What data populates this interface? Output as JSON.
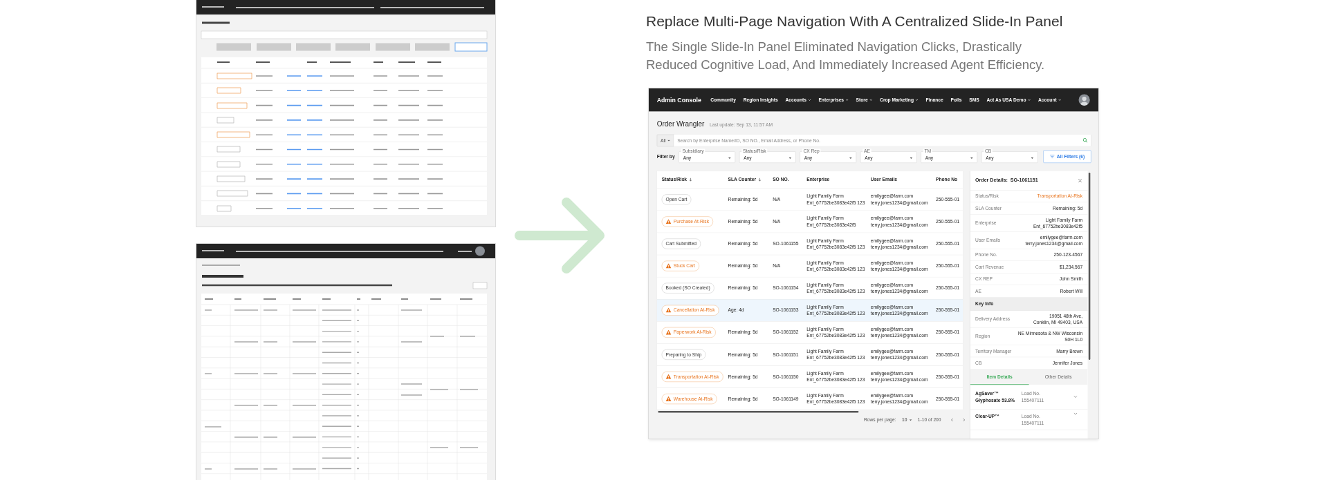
{
  "headline": "Replace Multi-Page Navigation With A Centralized Slide-In Panel",
  "description": [
    "The Single Slide-In Panel Eliminated Navigation Clicks, Drastically",
    "Reduced Cognitive Load, And Immediately Increased Agent Efficiency."
  ],
  "after_screen": {
    "nav": {
      "brand": "Admin Console",
      "avatar": true,
      "items": [
        {
          "label": "Community",
          "dropdown": false
        },
        {
          "label": "Region Insights",
          "dropdown": false
        },
        {
          "label": "Accounts",
          "dropdown": true
        },
        {
          "label": "Enterprises",
          "dropdown": true
        },
        {
          "label": "Store",
          "dropdown": true
        },
        {
          "label": "Crop Marketing",
          "dropdown": true
        },
        {
          "label": "Finance",
          "dropdown": false
        },
        {
          "label": "Polls",
          "dropdown": false
        },
        {
          "label": "SMS",
          "dropdown": false
        },
        {
          "label": "Act As USA Demo",
          "dropdown": true
        },
        {
          "label": "Account",
          "dropdown": true
        }
      ]
    },
    "title": "Order Wrangler",
    "last_update": "Last update: Sep 13, 11:57 AM",
    "search": {
      "scope": "All",
      "placeholder": "Search by Enterprise Name/ID, SO NO., Email Address, or Phone No."
    },
    "filter_label": "Filter by",
    "filters": [
      {
        "label": "Subsidiary",
        "value": "Any"
      },
      {
        "label": "Status/Risk",
        "value": "Any"
      },
      {
        "label": "CX Rep",
        "value": "Any"
      },
      {
        "label": "AE",
        "value": "Any"
      },
      {
        "label": "TM",
        "value": "Any"
      },
      {
        "label": "CB",
        "value": "Any"
      }
    ],
    "all_filters": "All Filters (6)",
    "columns": [
      {
        "label": "Status/Risk",
        "sorted": true
      },
      {
        "label": "SLA Counter",
        "sorted": true
      },
      {
        "label": "SO NO.",
        "sorted": false
      },
      {
        "label": "Enterprise",
        "sorted": false
      },
      {
        "label": "User Emails",
        "sorted": false
      },
      {
        "label": "Phone No",
        "sorted": false
      }
    ],
    "rows": [
      {
        "status": "Open Cart",
        "risk": false,
        "selected": false,
        "sla": "Remaining: 5d",
        "so_no": "N/A",
        "enterprise": [
          "Light Family Farm",
          "Ent_67752be3083e42f5 123"
        ],
        "emails": [
          "emilygee@farm.com",
          "terry.jones1234@gmail.com"
        ],
        "phone": "250-555-01"
      },
      {
        "status": "Purchase At-Risk",
        "risk": true,
        "selected": false,
        "sla": "Remaining: 5d",
        "so_no": "N/A",
        "enterprise": [
          "Light Family Farm",
          "Ent_67752be3083e42f5"
        ],
        "emails": [
          "emilygee@farm.com",
          "terry.jones1234@gmail.com"
        ],
        "phone": "250-555-01"
      },
      {
        "status": "Cart Submitted",
        "risk": false,
        "selected": false,
        "sla": "Remaining: 5d",
        "so_no": "SO-1061155",
        "enterprise": [
          "Light Family Farm",
          "Ent_67752be3083e42f5 123"
        ],
        "emails": [
          "emilygee@farm.com",
          "terry.jones1234@gmail.com"
        ],
        "phone": "250-555-01"
      },
      {
        "status": "Stuck Cart",
        "risk": true,
        "selected": false,
        "sla": "Remaining: 5d",
        "so_no": "N/A",
        "enterprise": [
          "Light Family Farm",
          "Ent_67752be3083e42f5 123"
        ],
        "emails": [
          "emilygee@farm.com",
          "terry.jones1234@gmail.com"
        ],
        "phone": "250-555-01"
      },
      {
        "status": "Booked (SO Created)",
        "risk": false,
        "selected": false,
        "sla": "Remaining: 5d",
        "so_no": "SO-1061154",
        "enterprise": [
          "Light Family Farm",
          "Ent_67752be3083e42f5 123"
        ],
        "emails": [
          "emilygee@farm.com",
          "terry.jones1234@gmail.com"
        ],
        "phone": "250-555-01"
      },
      {
        "status": "Cancellation At-Risk",
        "risk": true,
        "selected": true,
        "sla": "Age: 4d",
        "so_no": "SO-1061153",
        "enterprise": [
          "Light Family Farm",
          "Ent_67752be3083e42f5 123"
        ],
        "emails": [
          "emilygee@farm.com",
          "terry.jones1234@gmail.com"
        ],
        "phone": "250-555-01"
      },
      {
        "status": "Paperwork At-Risk",
        "risk": true,
        "selected": false,
        "sla": "Remaining: 5d",
        "so_no": "SO-1061152",
        "enterprise": [
          "Light Family Farm",
          "Ent_67752be3083e42f5 123"
        ],
        "emails": [
          "emilygee@farm.com",
          "terry.jones1234@gmail.com"
        ],
        "phone": "250-555-01"
      },
      {
        "status": "Preparing to Ship",
        "risk": false,
        "selected": false,
        "sla": "Remaining: 5d",
        "so_no": "SO-1061151",
        "enterprise": [
          "Light Family Farm",
          "Ent_67752be3083e42f5 123"
        ],
        "emails": [
          "emilygee@farm.com",
          "terry.jones1234@gmail.com"
        ],
        "phone": "250-555-01"
      },
      {
        "status": "Transportation At-Risk",
        "risk": true,
        "selected": false,
        "sla": "Remaining: 5d",
        "so_no": "SO-1061150",
        "enterprise": [
          "Light Family Farm",
          "Ent_67752be3083e42f5 123"
        ],
        "emails": [
          "emilygee@farm.com",
          "terry.jones1234@gmail.com"
        ],
        "phone": "250-555-01"
      },
      {
        "status": "Warehouse At-Risk",
        "risk": true,
        "selected": false,
        "sla": "Remaining: 5d",
        "so_no": "SO-1061149",
        "enterprise": [
          "Light Family Farm",
          "Ent_67752be3083e42f5 123"
        ],
        "emails": [
          "emilygee@farm.com",
          "terry.jones1234@gmail.com"
        ],
        "phone": "250-555-01"
      }
    ],
    "footer": {
      "rows_per_page_label": "Rows per page:",
      "rows_per_page": "10",
      "range": "1-10 of 200"
    },
    "panel": {
      "title": "Order Details:  SO-1061151",
      "fields": [
        {
          "label": "Status/Risk",
          "lines": [
            "Transportation At-Risk"
          ],
          "risk": true
        },
        {
          "label": "SLA Counter",
          "lines": [
            "Remaining: 5d"
          ],
          "risk": false
        },
        {
          "label": "Enterprise",
          "lines": [
            "Light Family Farm",
            "Ent_67752be3083e42f5"
          ],
          "risk": false
        },
        {
          "label": "User Emails",
          "lines": [
            "emilygee@farm.com",
            "terry.jones1234@gmail.com"
          ],
          "risk": false
        },
        {
          "label": "Phone No.",
          "lines": [
            "250-123-4567"
          ],
          "risk": false
        },
        {
          "label": "Cart Revenue",
          "lines": [
            "$1,234,567"
          ],
          "risk": false
        },
        {
          "label": "CX REP",
          "lines": [
            "John Smith"
          ],
          "risk": false
        },
        {
          "label": "AE",
          "lines": [
            "Robert Will"
          ],
          "risk": false
        }
      ],
      "key_info": {
        "title": "Key Info",
        "fields": [
          {
            "label": "Delivery Address",
            "lines": [
              "19051 48th Ave,",
              "Conklin, MI 49403, USA"
            ]
          },
          {
            "label": "Region",
            "lines": [
              "NE Minnesota & NW Wisconsin",
              "S0H 1L0"
            ]
          },
          {
            "label": "Territory Manager",
            "lines": [
              "Marry Brown"
            ]
          },
          {
            "label": "CB",
            "lines": [
              "Jennifer Jones"
            ]
          }
        ]
      },
      "tabs": [
        {
          "label": "Item Details",
          "selected": true
        },
        {
          "label": "Other Details",
          "selected": false
        }
      ],
      "items": [
        {
          "name": [
            "AgSaver™",
            "Glyphosate 53.8%"
          ],
          "load": [
            "Load No.",
            "155407111"
          ]
        },
        {
          "name": [
            "Clear-UP™"
          ],
          "load": [
            "Load No.",
            "155407111"
          ]
        }
      ]
    }
  }
}
